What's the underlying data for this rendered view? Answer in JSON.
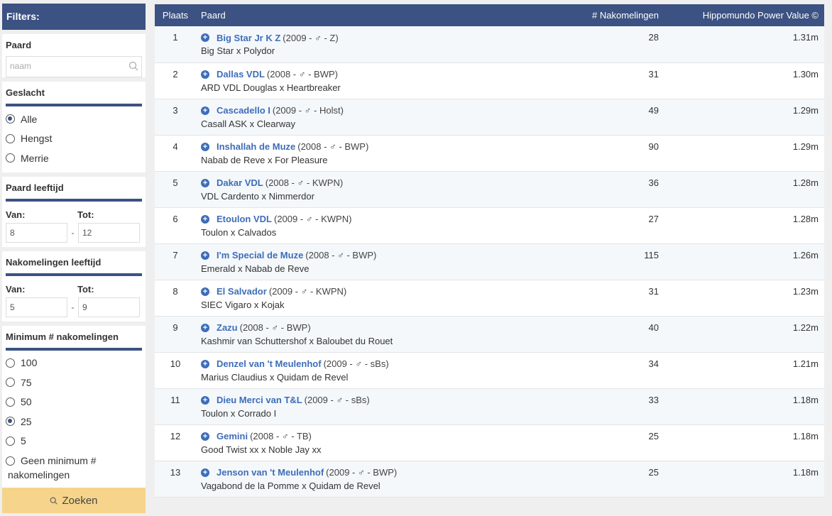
{
  "sidebar": {
    "header": "Filters:",
    "horse": {
      "title": "Paard",
      "placeholder": "naam"
    },
    "gender": {
      "title": "Geslacht",
      "options": [
        {
          "label": "Alle",
          "checked": true
        },
        {
          "label": "Hengst",
          "checked": false
        },
        {
          "label": "Merrie",
          "checked": false
        }
      ]
    },
    "horse_age": {
      "title": "Paard leeftijd",
      "from_label": "Van:",
      "to_label": "Tot:",
      "from": "8",
      "to": "12",
      "dash": "-"
    },
    "offspring_age": {
      "title": "Nakomelingen leeftijd",
      "from_label": "Van:",
      "to_label": "Tot:",
      "from": "5",
      "to": "9",
      "dash": "-"
    },
    "min_offspring": {
      "title": "Minimum # nakomelingen",
      "options": [
        {
          "label": "100",
          "checked": false
        },
        {
          "label": "75",
          "checked": false
        },
        {
          "label": "50",
          "checked": false
        },
        {
          "label": "25",
          "checked": true
        },
        {
          "label": "5",
          "checked": false
        }
      ],
      "none_label": "Geen minimum # nakomelingen"
    },
    "search_button": "Zoeken"
  },
  "table": {
    "headers": {
      "rank": "Plaats",
      "horse": "Paard",
      "offspring": "# Nakomelingen",
      "value": "Hippomundo Power Value ©"
    },
    "rows": [
      {
        "rank": "1",
        "name": "Big Star Jr K Z",
        "meta": "(2009 - ♂ - Z)",
        "pedigree": "Big Star x Polydor",
        "offspring": "28",
        "value": "1.31m"
      },
      {
        "rank": "2",
        "name": "Dallas VDL",
        "meta": "(2008 - ♂ - BWP)",
        "pedigree": "ARD VDL Douglas x Heartbreaker",
        "offspring": "31",
        "value": "1.30m"
      },
      {
        "rank": "3",
        "name": "Cascadello I",
        "meta": "(2009 - ♂ - Holst)",
        "pedigree": "Casall ASK x Clearway",
        "offspring": "49",
        "value": "1.29m"
      },
      {
        "rank": "4",
        "name": "Inshallah de Muze",
        "meta": "(2008 - ♂ - BWP)",
        "pedigree": "Nabab de Reve x For Pleasure",
        "offspring": "90",
        "value": "1.29m"
      },
      {
        "rank": "5",
        "name": "Dakar VDL",
        "meta": "(2008 - ♂ - KWPN)",
        "pedigree": "VDL Cardento x Nimmerdor",
        "offspring": "36",
        "value": "1.28m"
      },
      {
        "rank": "6",
        "name": "Etoulon VDL",
        "meta": "(2009 - ♂ - KWPN)",
        "pedigree": "Toulon x Calvados",
        "offspring": "27",
        "value": "1.28m"
      },
      {
        "rank": "7",
        "name": "I'm Special de Muze",
        "meta": "(2008 - ♂ - BWP)",
        "pedigree": "Emerald x Nabab de Reve",
        "offspring": "115",
        "value": "1.26m"
      },
      {
        "rank": "8",
        "name": "El Salvador",
        "meta": "(2009 - ♂ - KWPN)",
        "pedigree": "SIEC Vigaro x Kojak",
        "offspring": "31",
        "value": "1.23m"
      },
      {
        "rank": "9",
        "name": "Zazu",
        "meta": "(2008 - ♂ - BWP)",
        "pedigree": "Kashmir van Schuttershof x Baloubet du Rouet",
        "offspring": "40",
        "value": "1.22m"
      },
      {
        "rank": "10",
        "name": "Denzel van 't Meulenhof",
        "meta": "(2009 - ♂ - sBs)",
        "pedigree": "Marius Claudius x Quidam de Revel",
        "offspring": "34",
        "value": "1.21m"
      },
      {
        "rank": "11",
        "name": "Dieu Merci van T&L",
        "meta": "(2009 - ♂ - sBs)",
        "pedigree": "Toulon x Corrado I",
        "offspring": "33",
        "value": "1.18m"
      },
      {
        "rank": "12",
        "name": "Gemini",
        "meta": "(2008 - ♂ - TB)",
        "pedigree": "Good Twist xx x Noble Jay xx",
        "offspring": "25",
        "value": "1.18m"
      },
      {
        "rank": "13",
        "name": "Jenson van 't Meulenhof",
        "meta": "(2009 - ♂ - BWP)",
        "pedigree": "Vagabond de la Pomme x Quidam de Revel",
        "offspring": "25",
        "value": "1.18m"
      }
    ]
  },
  "colors": {
    "header_blue": "#3b5282",
    "link_blue": "#3e6db8",
    "button_yellow": "#f6d48b"
  },
  "icons": {
    "search": "magnifier-icon",
    "expand": "plus-circle-icon"
  }
}
